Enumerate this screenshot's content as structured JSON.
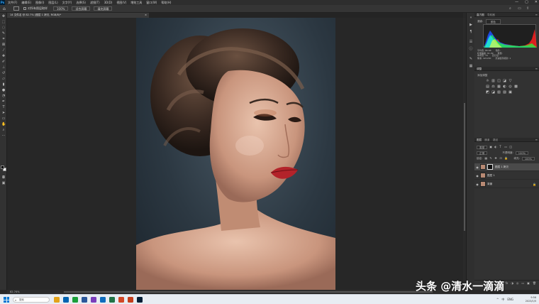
{
  "app": {
    "logo_text": "Ps",
    "menu": [
      "文件(F)",
      "编辑(E)",
      "图像(I)",
      "图层(L)",
      "文字(Y)",
      "选择(S)",
      "滤镜(T)",
      "3D(D)",
      "视图(V)",
      "增效工具",
      "窗口(W)",
      "帮助(H)"
    ],
    "window_controls": [
      "—",
      "▢",
      "✕"
    ]
  },
  "options_bar": {
    "home_icon": "home-icon",
    "check_label": "对所有图层取样",
    "zoom_value": "100%",
    "btn_fit": "适合屏幕",
    "btn_fill": "填充屏幕"
  },
  "document_tab": {
    "title": "14 文件名 @ 82.7% (图层 1 拷贝, RGB/8)*",
    "close": "×"
  },
  "statusbar": {
    "zoom": "82.74%"
  },
  "panels": {
    "histogram": {
      "tab1": "直方图",
      "tab2": "导航器",
      "channel_label": "通道:",
      "channel_value": "颜色",
      "stats": [
        [
          "平均值: 86.68",
          "色阶:"
        ],
        [
          "标准偏差: 61.09",
          "数量:"
        ],
        [
          "中间值: 70",
          "百分位:"
        ],
        [
          "像素: 421200",
          "高速缓存级别: 1"
        ]
      ],
      "colors": {
        "red": "#ff2020",
        "green": "#20ff40",
        "blue": "#2050ff",
        "cyan": "#20e0ff",
        "yellow": "#ffff30"
      }
    },
    "adjustments": {
      "tab1": "调整",
      "label": "添加调整",
      "row1": [
        "☼",
        "▥",
        "◫",
        "◪",
        "▽"
      ],
      "row2": [
        "▤",
        "⚖",
        "▦",
        "◐",
        "◎",
        "▩"
      ],
      "row3": [
        "◩",
        "◪",
        "▧",
        "▨",
        "▣"
      ]
    },
    "layers": {
      "tab1": "图层",
      "tab2": "通道",
      "tab3": "路径",
      "filter_label": "类型",
      "blend_mode": "正常",
      "opacity_label": "不透明度:",
      "opacity_value": "100%",
      "lock_label": "锁定:",
      "fill_label": "填充:",
      "fill_value": "100%",
      "items": [
        {
          "name": "图层 1 拷贝",
          "active": true,
          "has_mask": true
        },
        {
          "name": "图层 1",
          "active": false,
          "has_mask": false
        },
        {
          "name": "背景",
          "active": false,
          "has_mask": false
        }
      ],
      "footer": [
        "⛓",
        "fx",
        "◑",
        "◎",
        "▭",
        "▣",
        "🗑"
      ]
    }
  },
  "taskbar": {
    "search_placeholder": "搜索",
    "apps": [
      "#e3a21a",
      "#0063b1",
      "#1a9e3a",
      "#2b579a",
      "#7a3dbb",
      "#0f6cbd",
      "#217346",
      "#d24726",
      "#c43e1c",
      "#001e36"
    ],
    "tray_icons": [
      "^",
      "中",
      "ENG"
    ],
    "time": "9:56",
    "date": "2023/1/5"
  },
  "watermark": "头条 @清水一滴滴"
}
